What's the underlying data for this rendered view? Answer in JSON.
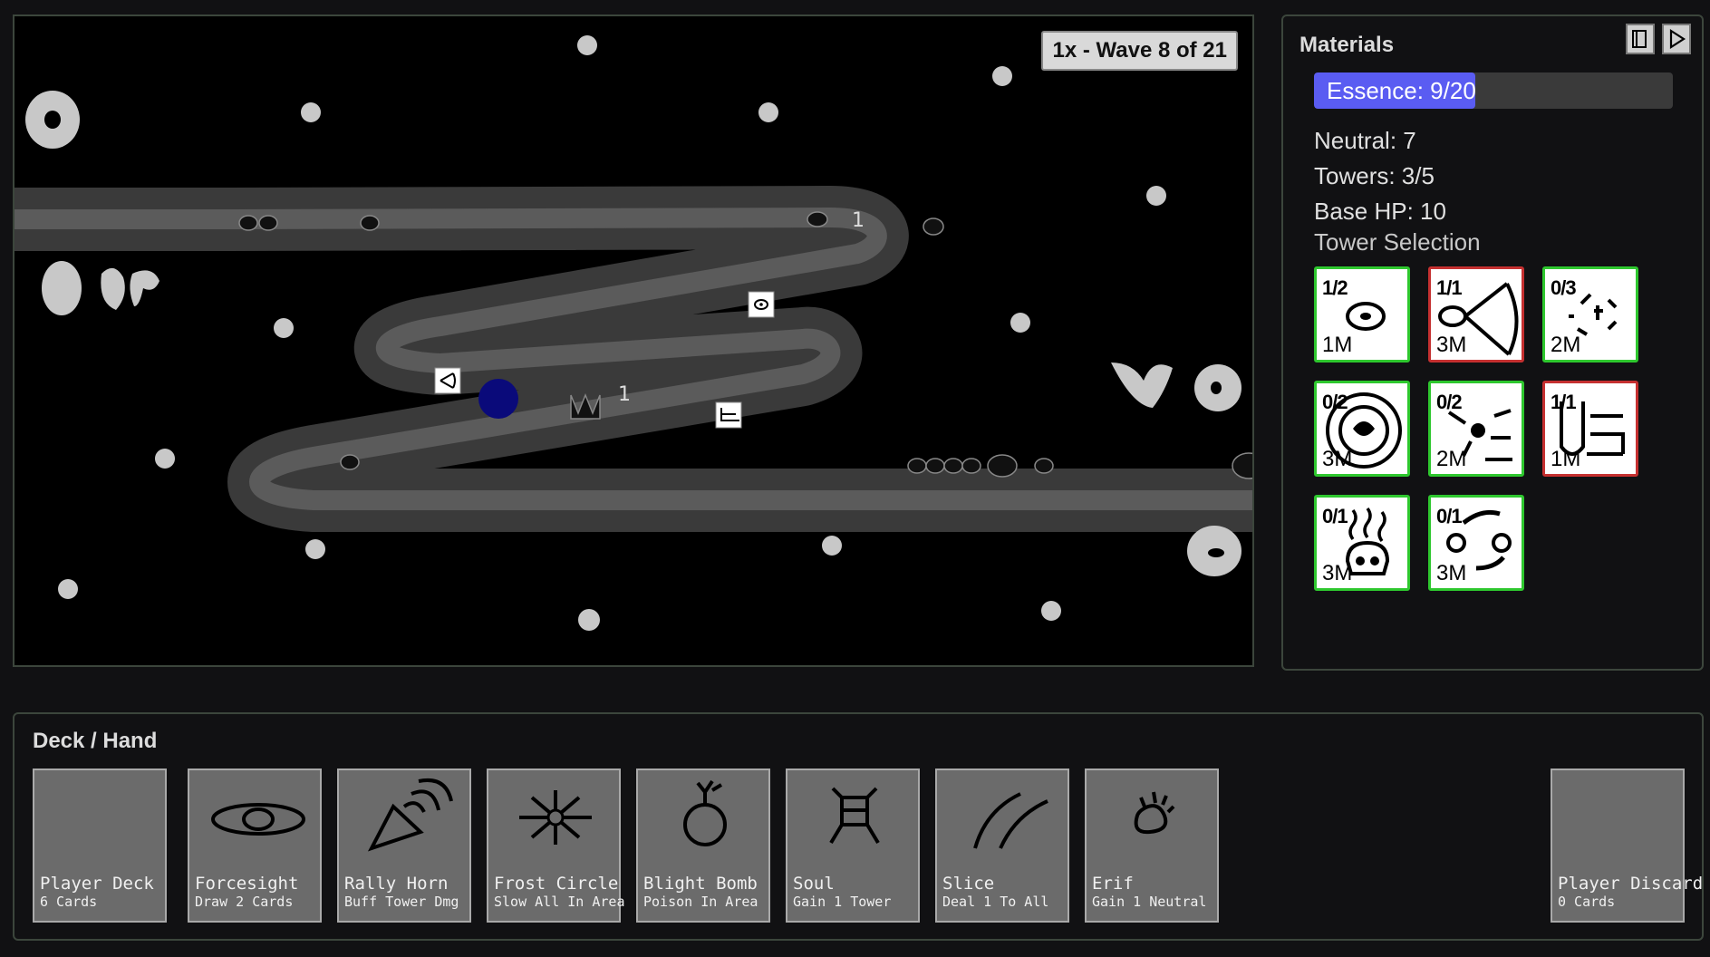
{
  "game": {
    "wave_badge": "1x - Wave 8 of 21",
    "damage_labels": [
      "1",
      "1"
    ]
  },
  "materials": {
    "title": "Materials",
    "essence_label": "Essence: 9/20",
    "essence_fraction": 0.45,
    "neutral": "Neutral: 7",
    "towers": "Towers: 3/5",
    "base_hp": "Base HP: 10",
    "tower_selection_label": "Tower Selection",
    "buttons": [
      {
        "icon": "book-icon"
      },
      {
        "icon": "play-icon"
      }
    ],
    "towers_list": [
      {
        "count": "1/2",
        "cost": "1M",
        "icon": "eye-tower-icon",
        "status": "available"
      },
      {
        "count": "1/1",
        "cost": "3M",
        "icon": "horn-tower-icon",
        "status": "locked"
      },
      {
        "count": "0/3",
        "cost": "2M",
        "icon": "frost-tower-icon",
        "status": "available"
      },
      {
        "count": "0/2",
        "cost": "3M",
        "icon": "vortex-tower-icon",
        "status": "available"
      },
      {
        "count": "0/2",
        "cost": "2M",
        "icon": "blade-tower-icon",
        "status": "available"
      },
      {
        "count": "1/1",
        "cost": "1M",
        "icon": "fist-tower-icon",
        "status": "locked"
      },
      {
        "count": "0/1",
        "cost": "3M",
        "icon": "skull-tower-icon",
        "status": "available"
      },
      {
        "count": "0/1",
        "cost": "3M",
        "icon": "face-tower-icon",
        "status": "available"
      }
    ],
    "colors": {
      "available": "#2ec72e",
      "locked": "#c53030",
      "essence": "#5a5cf2"
    }
  },
  "deck": {
    "title": "Deck / Hand",
    "cards": [
      {
        "name": "Player Deck",
        "desc": "6 Cards",
        "icon": ""
      },
      {
        "name": "Forcesight",
        "desc": "Draw 2 Cards",
        "icon": "eye-icon"
      },
      {
        "name": "Rally Horn",
        "desc": "Buff Tower Dmg",
        "icon": "horn-icon"
      },
      {
        "name": "Frost Circle",
        "desc": "Slow All In Area",
        "icon": "snowflake-icon"
      },
      {
        "name": "Blight Bomb",
        "desc": "Poison In Area",
        "icon": "bomb-icon"
      },
      {
        "name": "Soul",
        "desc": "Gain 1 Tower",
        "icon": "soul-icon"
      },
      {
        "name": "Slice",
        "desc": "Deal 1 To All",
        "icon": "slash-icon"
      },
      {
        "name": "Erif",
        "desc": "Gain 1 Neutral",
        "icon": "flame-icon"
      }
    ],
    "discard": {
      "name": "Player Discard",
      "desc": "0 Cards"
    }
  }
}
